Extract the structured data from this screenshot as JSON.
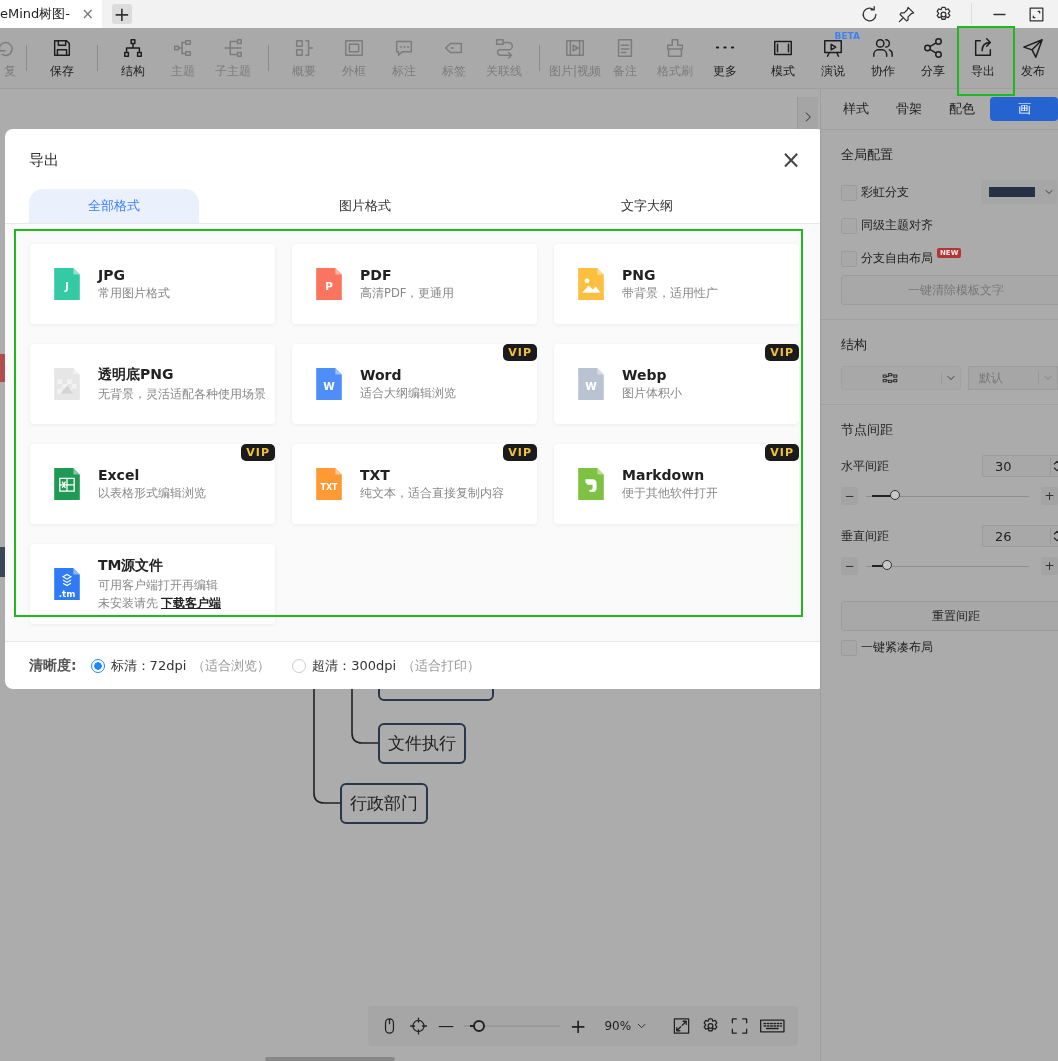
{
  "title_bar": {
    "tab_title": "eMind树图-",
    "tab_close": "×",
    "new_tab": "+"
  },
  "toolbar": {
    "left_groups": [
      [
        {
          "label": "复",
          "disabled": true
        }
      ],
      [
        {
          "label": "保存",
          "disabled": false
        }
      ],
      [
        {
          "label": "结构",
          "disabled": false
        },
        {
          "label": "主题",
          "disabled": true
        },
        {
          "label": "子主题",
          "disabled": true
        }
      ],
      [
        {
          "label": "概要",
          "disabled": true
        },
        {
          "label": "外框",
          "disabled": true
        },
        {
          "label": "标注",
          "disabled": true
        },
        {
          "label": "标签",
          "disabled": true
        },
        {
          "label": "关联线",
          "disabled": true
        }
      ],
      [
        {
          "label": "图片|视频",
          "disabled": true
        },
        {
          "label": "备注",
          "disabled": true
        },
        {
          "label": "格式刷",
          "disabled": true
        },
        {
          "label": "更多",
          "disabled": false
        }
      ]
    ],
    "right_items": [
      {
        "label": "模式"
      },
      {
        "label": "演说",
        "badge": "BETA"
      },
      {
        "label": "协作"
      },
      {
        "label": "分享"
      },
      {
        "label": "导出"
      },
      {
        "label": "发布"
      }
    ]
  },
  "mind_map": {
    "nodes": [
      {
        "text": "文件执行"
      },
      {
        "text": "行政部门"
      }
    ]
  },
  "dialog": {
    "title": "导出",
    "close": "×",
    "tabs": [
      {
        "label": "全部格式",
        "selected": true
      },
      {
        "label": "图片格式",
        "selected": false
      },
      {
        "label": "文字大纲",
        "selected": false
      }
    ],
    "formats": [
      {
        "name": "JPG",
        "description": "常用图片格式",
        "kind": "letter",
        "icon_text": "J",
        "color": "#35c9a5"
      },
      {
        "name": "PDF",
        "description": "高清PDF，更通用",
        "kind": "letter",
        "icon_text": "P",
        "color": "#fb7460"
      },
      {
        "name": "PNG",
        "description": "带背景，适用性广",
        "kind": "image",
        "color": "#fdbf3f"
      },
      {
        "name": "透明底PNG",
        "description": "无背景，灵活适配各种使用场景",
        "kind": "transparent",
        "color": "#e6e6e6"
      },
      {
        "name": "Word",
        "description": "适合大纲编辑浏览",
        "kind": "letter",
        "icon_text": "W",
        "color": "#4f8ef8",
        "vip_label": "VIP"
      },
      {
        "name": "Webp",
        "description": "图片体积小",
        "kind": "letter",
        "icon_text": "W",
        "color": "#b9c3d2",
        "vip_label": "VIP"
      },
      {
        "name": "Excel",
        "description": "以表格形式编辑浏览",
        "kind": "sheet",
        "color": "#1f9a55",
        "vip_label": "VIP"
      },
      {
        "name": "TXT",
        "description": "纯文本，适合直接复制内容",
        "kind": "letter",
        "icon_text": "TXT",
        "color": "#fd9a34",
        "vip_label": "VIP"
      },
      {
        "name": "Markdown",
        "description": "便于其他软件打开",
        "kind": "note",
        "color": "#7dc243",
        "vip_label": "VIP"
      },
      {
        "name": "TM源文件",
        "description": "可用客户端打开再编辑",
        "kind": "source",
        "icon_text": ".tm",
        "color": "#2f7bf6",
        "hint": "未安装请先",
        "link": "下载客户端"
      }
    ],
    "quality": {
      "label": "清晰度:",
      "options": [
        {
          "label": "标清：72dpi",
          "note": "（适合浏览）",
          "selected": true
        },
        {
          "label": "超清：300dpi",
          "note": "（适合打印）",
          "selected": false
        }
      ]
    }
  },
  "right_panel": {
    "tabs": [
      {
        "label": "样式",
        "selected": false
      },
      {
        "label": "骨架",
        "selected": false
      },
      {
        "label": "配色",
        "selected": false
      },
      {
        "label": "画",
        "selected": true
      }
    ],
    "global": {
      "heading": "全局配置",
      "options": [
        {
          "label": "彩虹分支",
          "checked": false
        },
        {
          "label": "同级主题对齐",
          "checked": false
        },
        {
          "label": "分支自由布局",
          "checked": false,
          "badge": "NEW"
        }
      ],
      "clear_button": "一键清除模板文字"
    },
    "structure": {
      "heading": "结构",
      "style_select": "默认"
    },
    "spacing": {
      "heading": "节点间距",
      "rows": [
        {
          "label": "水平间距",
          "value": "30",
          "minus": "−",
          "plus": "+",
          "level": 0.18
        },
        {
          "label": "垂直间距",
          "value": "26",
          "minus": "−",
          "plus": "+",
          "level": 0.13
        }
      ],
      "reset_button": "重置间距"
    },
    "compact": {
      "label": "一键紧凑布局",
      "checked": false
    }
  },
  "zoom_bar": {
    "minus": "—",
    "plus": "+",
    "level": 0.15,
    "zoom": "90%"
  }
}
